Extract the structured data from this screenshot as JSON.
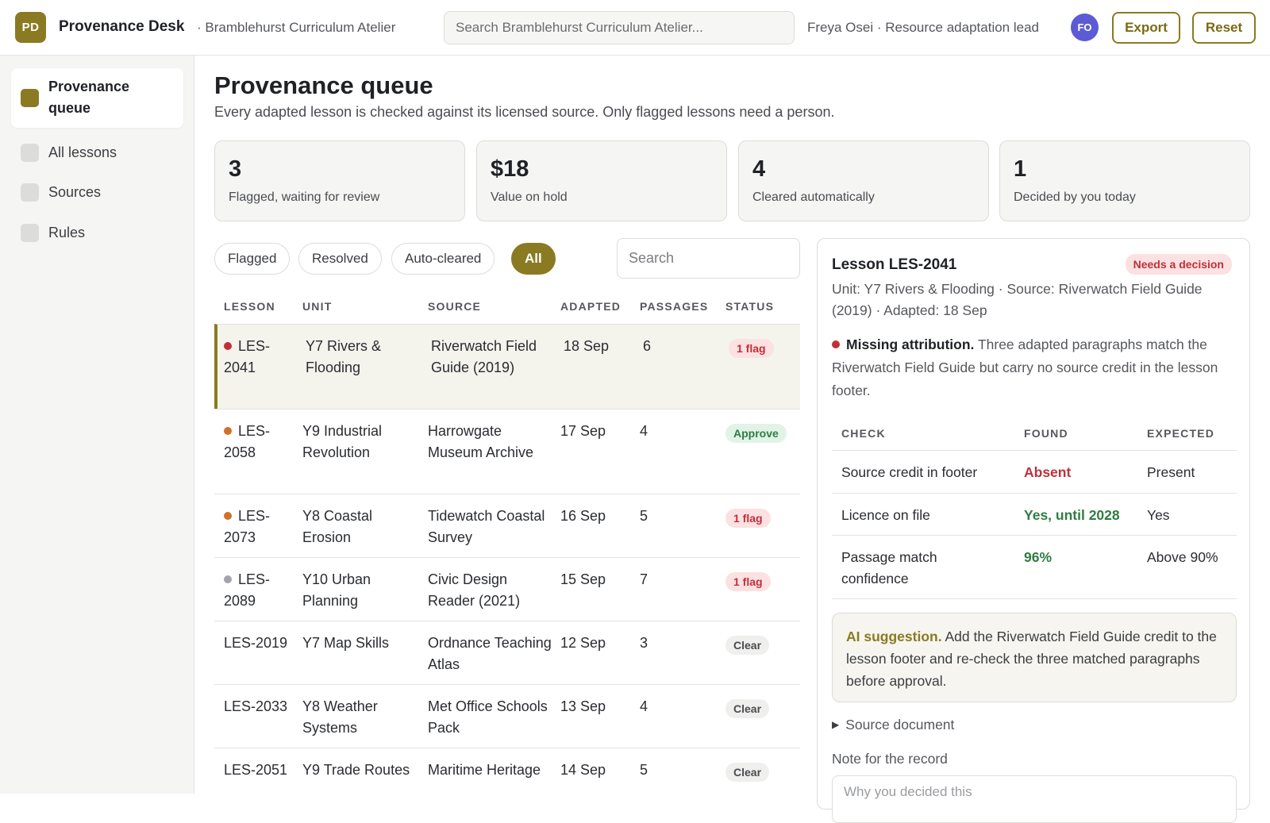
{
  "header": {
    "logo": "PD",
    "app_name": "Provenance Desk",
    "workspace": "· Bramblehurst Curriculum Atelier",
    "search_placeholder": "Search Bramblehurst Curriculum Atelier...",
    "user": "Freya Osei · Resource adaptation lead",
    "avatar": "FO",
    "export_label": "Export",
    "reset_label": "Reset"
  },
  "sidebar": {
    "items": [
      {
        "label": "Provenance queue",
        "active": true
      },
      {
        "label": "All lessons",
        "active": false
      },
      {
        "label": "Sources",
        "active": false
      },
      {
        "label": "Rules",
        "active": false
      }
    ]
  },
  "main": {
    "title": "Provenance queue",
    "subtitle": "Every adapted lesson is checked against its licensed source. Only flagged lessons need a person.",
    "stats": [
      {
        "value": "3",
        "label": "Flagged, waiting for review"
      },
      {
        "value": "$18",
        "label": "Value on hold"
      },
      {
        "value": "4",
        "label": "Cleared automatically"
      },
      {
        "value": "1",
        "label": "Decided by you today"
      }
    ],
    "filters": [
      "Flagged",
      "Resolved",
      "Auto-cleared",
      "All"
    ],
    "active_filter": "All",
    "search_placeholder": "Search"
  },
  "table": {
    "columns": [
      "LESSON",
      "UNIT",
      "SOURCE",
      "ADAPTED",
      "PASSAGES",
      "STATUS"
    ],
    "rows": [
      {
        "lesson": "LES-2041",
        "unit": "Y7 Rivers & Flooding",
        "source": "Riverwatch Field Guide (2019)",
        "adapted": "18 Sep",
        "passages": "6",
        "status": "1 flag",
        "status_kind": "flag",
        "dot": "#c0303a",
        "selected": true
      },
      {
        "lesson": "LES-2058",
        "unit": "Y9 Industrial Revolution",
        "source": "Harrowgate Museum Archive",
        "adapted": "17 Sep",
        "passages": "4",
        "status": "Approve",
        "status_kind": "approve",
        "dot": "#d0702a",
        "selected": false
      },
      {
        "lesson": "LES-2073",
        "unit": "Y8 Coastal Erosion",
        "source": "Tidewatch Coastal Survey",
        "adapted": "16 Sep",
        "passages": "5",
        "status": "1 flag",
        "status_kind": "flag",
        "dot": "#d0702a",
        "selected": false
      },
      {
        "lesson": "LES-2089",
        "unit": "Y10 Urban Planning",
        "source": "Civic Design Reader (2021)",
        "adapted": "15 Sep",
        "passages": "7",
        "status": "1 flag",
        "status_kind": "flag",
        "dot": "#a3a3b0",
        "selected": false
      },
      {
        "lesson": "LES-2019",
        "unit": "Y7 Map Skills",
        "source": "Ordnance Teaching Atlas",
        "adapted": "12 Sep",
        "passages": "3",
        "status": "Clear",
        "status_kind": "clear",
        "dot": "",
        "selected": false
      },
      {
        "lesson": "LES-2033",
        "unit": "Y8 Weather Systems",
        "source": "Met Office Schools Pack",
        "adapted": "13 Sep",
        "passages": "4",
        "status": "Clear",
        "status_kind": "clear",
        "dot": "",
        "selected": false
      },
      {
        "lesson": "LES-2051",
        "unit": "Y9 Trade Routes",
        "source": "Maritime Heritage",
        "adapted": "14 Sep",
        "passages": "5",
        "status": "Clear",
        "status_kind": "clear",
        "dot": "",
        "selected": false
      }
    ]
  },
  "detail": {
    "title": "Lesson LES-2041",
    "badge": "Needs a decision",
    "meta": "Unit: Y7 Rivers & Flooding · Source: Riverwatch Field Guide (2019) · Adapted: 18 Sep",
    "issue_title": "Missing attribution.",
    "issue_text": "Three adapted paragraphs match the Riverwatch Field Guide but carry no source credit in the lesson footer.",
    "check_columns": [
      "CHECK",
      "FOUND",
      "EXPECTED"
    ],
    "checks": [
      {
        "check": "Source credit in footer",
        "found": "Absent",
        "expected": "Present",
        "kind": "bad"
      },
      {
        "check": "Licence on file",
        "found": "Yes, until 2028",
        "expected": "Yes",
        "kind": "good"
      },
      {
        "check": "Passage match confidence",
        "found": "96%",
        "expected": "Above 90%",
        "kind": "good"
      }
    ],
    "ai_title": "AI suggestion.",
    "ai_text": "Add the Riverwatch Field Guide credit to the lesson footer and re-check the three matched paragraphs before approval.",
    "source_toggle": "Source document",
    "note_label": "Note for the record",
    "note_placeholder": "Why you decided this"
  },
  "colors": {
    "accent": "#8a7a22",
    "flag": "#c0303a",
    "approve": "#2f7d43",
    "avatar": "#5b5bd6"
  }
}
